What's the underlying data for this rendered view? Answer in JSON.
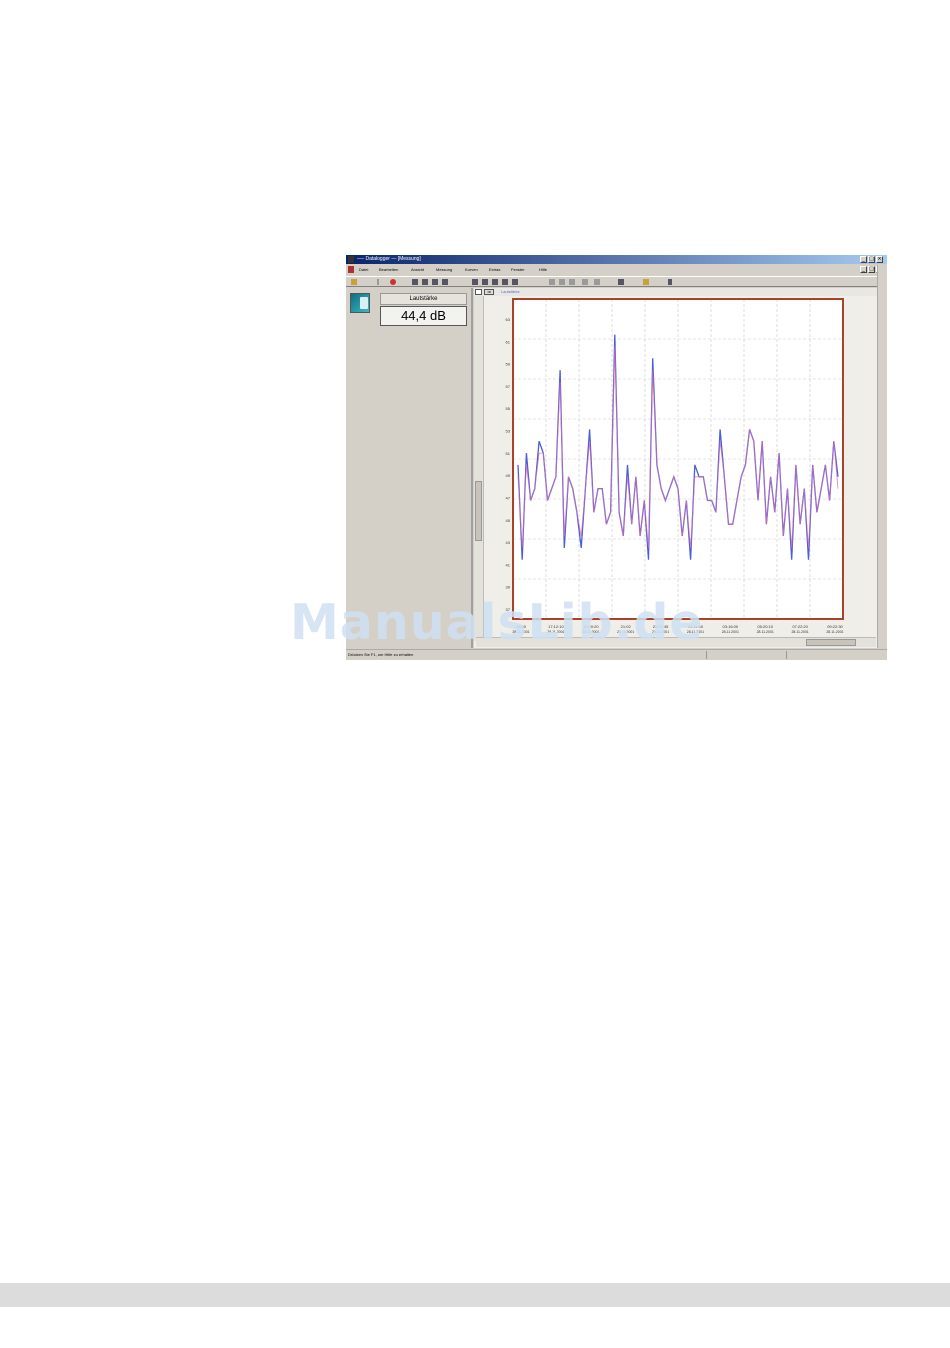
{
  "window": {
    "title": "── Datalogger — [Messung]",
    "controls": [
      "_",
      "□",
      "×"
    ]
  },
  "menu": {
    "items": [
      "Datei",
      "Bearbeiten",
      "Ansicht",
      "Messung",
      "Kurven",
      "Extras",
      "Fenster",
      "Hilfe"
    ]
  },
  "toolbar": {
    "icons": [
      "open-icon",
      "record-icon",
      "table-icon",
      "table-icon",
      "table-icon",
      "table-icon",
      "chart-icon",
      "chart-icon",
      "chart-icon",
      "chart-icon",
      "chart-icon",
      "zoom-icon",
      "zoom-icon",
      "zoom-icon",
      "zoom-icon",
      "zoom-icon",
      "cursor-icon",
      "print-icon",
      "help-icon"
    ]
  },
  "left_panel": {
    "label": "Lautstärke",
    "value": "44,4 dB",
    "icon": "probe-icon"
  },
  "graph_window": {
    "channel_label": "Lautstärke",
    "button_a": "",
    "button_b": "dB"
  },
  "status": {
    "text": "Drücken Sie F1, um Hilfe zu erhalten"
  },
  "watermark": "ManualsLib.de",
  "colors": {
    "plot_frame": "#a8432a",
    "series_a": "#4a5fd6",
    "series_b": "#d96fb0",
    "grid": "#c9c9c9",
    "titlebar_start": "#0a246a",
    "titlebar_end": "#a6caf0"
  },
  "chart_data": {
    "type": "line",
    "ylim": [
      35,
      62
    ],
    "y_ticks": [
      "63",
      "61",
      "59",
      "57",
      "55",
      "53",
      "51",
      "49",
      "47",
      "45",
      "43",
      "41",
      "39",
      "37"
    ],
    "x_tick_labels": [
      {
        "time": "16:00",
        "date": "28.11.2001"
      },
      {
        "time": "17:12:10",
        "date": "28.11.2001"
      },
      {
        "time": "19:00:20",
        "date": "28.11.2001"
      },
      {
        "time": "21:02",
        "date": "28.11.2001"
      },
      {
        "time": "23:07:45",
        "date": "28.11.2001"
      },
      {
        "time": "01:11:50",
        "date": "28.11.2001"
      },
      {
        "time": "03:16:00",
        "date": "28.11.2001"
      },
      {
        "time": "05:20:10",
        "date": "28.11.2001"
      },
      {
        "time": "07:22:20",
        "date": "28.11.2001"
      },
      {
        "time": "09:22:30",
        "date": "28.11.2001"
      }
    ],
    "series": [
      {
        "values": [
          48,
          40,
          49,
          45,
          46,
          50,
          49,
          45,
          46,
          47,
          56,
          41,
          47,
          46,
          44,
          41,
          46,
          51,
          44,
          46,
          46,
          43,
          44,
          59,
          44,
          42,
          48,
          43,
          47,
          42,
          45,
          40,
          57,
          48,
          46,
          45,
          46,
          47,
          46,
          42,
          45,
          40,
          48,
          47,
          47,
          45,
          45,
          44,
          51,
          47,
          43,
          43,
          45,
          47,
          48,
          51,
          50,
          45,
          50,
          43,
          47,
          44,
          49,
          42,
          46,
          40,
          48,
          43,
          46,
          40,
          48,
          44,
          46,
          48,
          45,
          50,
          47
        ]
      },
      {
        "values": [
          47,
          41,
          48,
          45,
          46,
          49,
          49,
          45,
          46,
          47,
          55,
          42,
          47,
          46,
          44,
          42,
          46,
          50,
          44,
          46,
          46,
          43,
          44,
          58,
          44,
          42,
          47,
          43,
          47,
          42,
          45,
          41,
          56,
          48,
          46,
          45,
          46,
          47,
          46,
          42,
          45,
          41,
          47,
          47,
          47,
          45,
          45,
          44,
          50,
          47,
          43,
          43,
          45,
          47,
          48,
          51,
          50,
          45,
          50,
          43,
          47,
          44,
          49,
          42,
          46,
          41,
          48,
          43,
          46,
          41,
          48,
          44,
          46,
          48,
          45,
          50,
          46
        ]
      }
    ]
  }
}
